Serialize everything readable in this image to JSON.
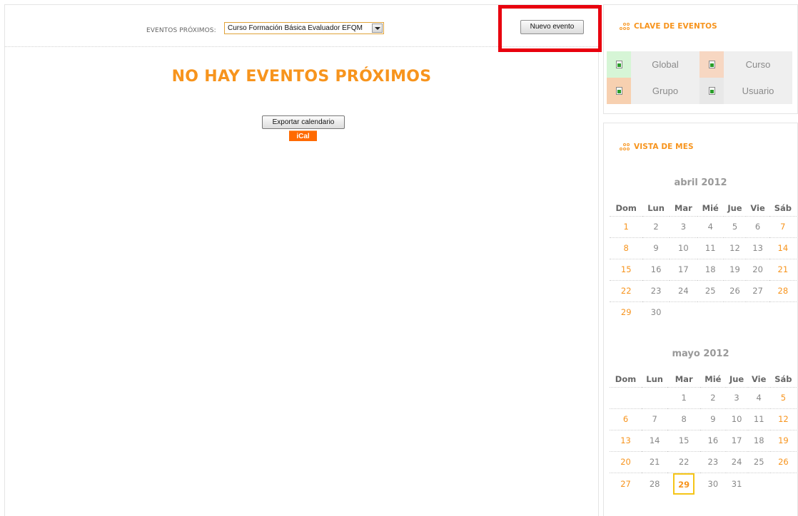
{
  "upcoming": {
    "label": "EVENTOS PRÓXIMOS:",
    "course_selected": "Curso Formación Básica Evaluador EFQM",
    "new_event_label": "Nuevo evento",
    "empty_message": "NO HAY EVENTOS PRÓXIMOS",
    "export_label": "Exportar calendario",
    "ical_label": "iCal"
  },
  "key_block": {
    "title": "CLAVE DE EVENTOS",
    "items": [
      {
        "label": "Global",
        "color": "#d6f5d6"
      },
      {
        "label": "Curso",
        "color": "#f7d7c2"
      },
      {
        "label": "Grupo",
        "color": "#f7d0b0"
      },
      {
        "label": "Usuario",
        "color": "#e8e8e8"
      }
    ]
  },
  "month_block": {
    "title": "VISTA DE MES",
    "weekdays": [
      "Dom",
      "Lun",
      "Mar",
      "Mié",
      "Jue",
      "Vie",
      "Sáb"
    ],
    "months": [
      {
        "name": "abril 2012",
        "weeks": [
          [
            "1",
            "2",
            "3",
            "4",
            "5",
            "6",
            "7"
          ],
          [
            "8",
            "9",
            "10",
            "11",
            "12",
            "13",
            "14"
          ],
          [
            "15",
            "16",
            "17",
            "18",
            "19",
            "20",
            "21"
          ],
          [
            "22",
            "23",
            "24",
            "25",
            "26",
            "27",
            "28"
          ],
          [
            "29",
            "30",
            "",
            "",
            "",
            "",
            ""
          ]
        ]
      },
      {
        "name": "mayo 2012",
        "weeks": [
          [
            "",
            "",
            "1",
            "2",
            "3",
            "4",
            "5"
          ],
          [
            "6",
            "7",
            "8",
            "9",
            "10",
            "11",
            "12"
          ],
          [
            "13",
            "14",
            "15",
            "16",
            "17",
            "18",
            "19"
          ],
          [
            "20",
            "21",
            "22",
            "23",
            "24",
            "25",
            "26"
          ],
          [
            "27",
            "28",
            "29",
            "30",
            "31",
            "",
            ""
          ]
        ],
        "today": "29"
      }
    ]
  },
  "colors": {
    "accent": "#f7941d",
    "highlight": "#e8000e",
    "ical": "#ff6a00"
  }
}
